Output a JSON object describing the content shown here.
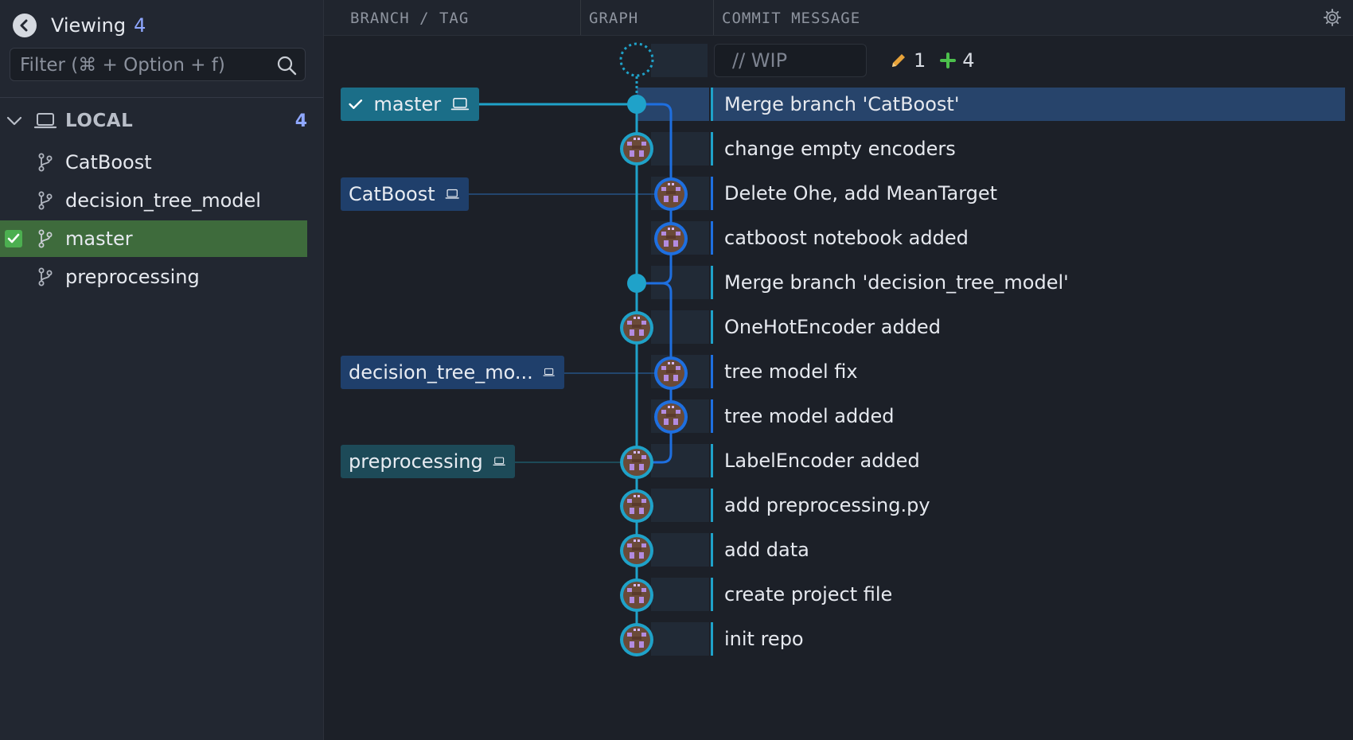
{
  "sidebar": {
    "viewing_label": "Viewing",
    "viewing_count": "4",
    "filter_placeholder": "Filter (⌘ + Option + f)",
    "local_label": "LOCAL",
    "local_count": "4",
    "branches": [
      {
        "name": "CatBoost",
        "active": false
      },
      {
        "name": "decision_tree_model",
        "active": false
      },
      {
        "name": "master",
        "active": true
      },
      {
        "name": "preprocessing",
        "active": false
      }
    ]
  },
  "header": {
    "col_branch": "BRANCH / TAG",
    "col_graph": "GRAPH",
    "col_message": "COMMIT MESSAGE"
  },
  "wip": {
    "placeholder": "// WIP",
    "modified_count": "1",
    "added_count": "4"
  },
  "refs": [
    {
      "label": "master",
      "current": true
    },
    {
      "label": "CatBoost"
    },
    {
      "label": "decision_tree_mo..."
    },
    {
      "label": "preprocessing"
    }
  ],
  "commits": [
    {
      "message": "Merge branch 'CatBoost'",
      "selected": true
    },
    {
      "message": "change empty encoders"
    },
    {
      "message": "Delete Ohe, add MeanTarget"
    },
    {
      "message": "catboost notebook added"
    },
    {
      "message": "Merge branch 'decision_tree_model'"
    },
    {
      "message": "OneHotEncoder added"
    },
    {
      "message": "tree model fix"
    },
    {
      "message": "tree model added"
    },
    {
      "message": "LabelEncoder added"
    },
    {
      "message": "add preprocessing.py"
    },
    {
      "message": "add data"
    },
    {
      "message": "create project file"
    },
    {
      "message": "init repo"
    }
  ],
  "colors": {
    "lane_main": "#1fa2c9",
    "lane_branch": "#1e6fe0",
    "selected_row": "#27446b",
    "active_branch": "#3e6b3c",
    "accent_count": "#8fa7ff"
  },
  "icons": [
    "back-arrow-icon",
    "search-icon",
    "chevron-down-icon",
    "laptop-icon",
    "branch-icon",
    "check-icon",
    "gear-icon",
    "pencil-icon",
    "plus-icon",
    "avatar-icon"
  ]
}
